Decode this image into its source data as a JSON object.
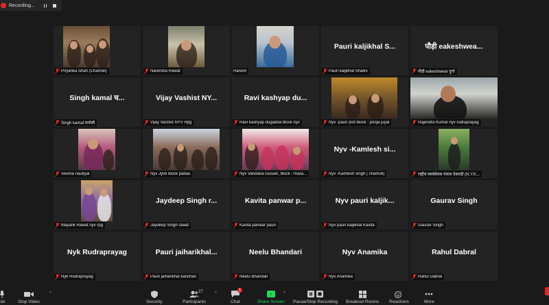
{
  "recording": {
    "label": "Recording..."
  },
  "participants": [
    {
      "caption": "Priyanka Shah (Chamoli)",
      "video": "vid-a",
      "tile_text": ""
    },
    {
      "caption": "Narendra Rawat",
      "video": "vid-b",
      "tile_text": ""
    },
    {
      "caption": "Hariom",
      "video": "vid-c",
      "tile_text": ""
    },
    {
      "caption": "Pauri kaljikhal Shalini",
      "video": "",
      "tile_text": "Pauri kaljikhal S..."
    },
    {
      "caption": "पौड़ी eakeshwear दुर्गा",
      "video": "",
      "tile_text": "पौड़ी eakeshwea..."
    },
    {
      "caption": "Singh kamal चमोली",
      "video": "",
      "tile_text": "Singh kamal च..."
    },
    {
      "caption": "Vijay Vashist NYV Rpg",
      "video": "",
      "tile_text": "Vijay Vashist NY..."
    },
    {
      "caption": "Ravi kashyap dugadda block nyv",
      "video": "",
      "tile_text": "Ravi kashyap du..."
    },
    {
      "caption": "Nyv -pauri (kot block : pooja juyal",
      "video": "vid-d",
      "tile_text": ""
    },
    {
      "caption": "Rajendra Kumar nyv rudraprayag",
      "video": "vid-e",
      "tile_text": ""
    },
    {
      "caption": "Seema nautiyal",
      "video": "vid-f",
      "tile_text": ""
    },
    {
      "caption": "Nyv Jyoti block pabau",
      "video": "vid-g",
      "tile_text": ""
    },
    {
      "caption": "Nyv Vandana Gusain, block -Thara...",
      "video": "vid-h",
      "tile_text": ""
    },
    {
      "caption": "Nyv -Kamlesh singh ( chamoli)",
      "video": "",
      "tile_text": "Nyv -Kamlesh si..."
    },
    {
      "caption": "राष्ट्रीय स्वयंसेवक पंकज देवराड़ी (N.Y.K...",
      "video": "vid-i",
      "tile_text": ""
    },
    {
      "caption": "Mayank Rawat nyv rpg",
      "video": "vid-j",
      "tile_text": ""
    },
    {
      "caption": "Jaydeep Singh rawat",
      "video": "",
      "tile_text": "Jaydeep Singh r..."
    },
    {
      "caption": "Kavita panwar pauri",
      "video": "",
      "tile_text": "Kavita panwar p..."
    },
    {
      "caption": "Nyv pauri kaljikhal Kavita",
      "video": "",
      "tile_text": "Nyv pauri kaljik..."
    },
    {
      "caption": "Gaurav Singh",
      "video": "",
      "tile_text": "Gaurav Singh"
    },
    {
      "caption": "Nyk Rudraprayag",
      "video": "",
      "tile_text": "Nyk Rudraprayag"
    },
    {
      "caption": "Pauri jaiharikhal kanchan",
      "video": "",
      "tile_text": "Pauri jaiharikhal..."
    },
    {
      "caption": "Neelu Bhandari",
      "video": "",
      "tile_text": "Neelu Bhandari"
    },
    {
      "caption": "Nyv Anamika",
      "video": "",
      "tile_text": "Nyv Anamika"
    },
    {
      "caption": "Rahul Dabral",
      "video": "",
      "tile_text": "Rahul Dabral"
    }
  ],
  "toolbar": {
    "mute_label": "ute",
    "video_label": "Stop Video",
    "security_label": "Security",
    "participants_label": "Participants",
    "participants_count": "27",
    "chat_label": "Chat",
    "chat_badge": "1",
    "share_label": "Share Screen",
    "record_label": "Pause/Stop Recording",
    "breakout_label": "Breakout Rooms",
    "reactions_label": "Reactions",
    "more_label": "More"
  },
  "colors": {
    "share": "#23d959",
    "muted": "#e02828",
    "end": "#e02828"
  }
}
